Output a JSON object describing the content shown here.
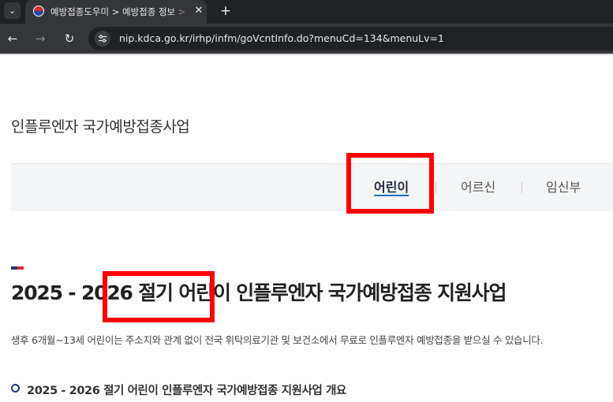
{
  "browser": {
    "tab": {
      "title": "예방접종도우미 > 예방접종 정보 > 인플루엔자",
      "close_glyph": "✕",
      "favicon": "korea-government-icon"
    },
    "new_tab_glyph": "+",
    "tab_list_glyph": "⌄",
    "nav": {
      "back_glyph": "←",
      "forward_glyph": "→",
      "reload_glyph": "↻"
    },
    "url": "nip.kdca.go.kr/irhp/infm/goVcntInfo.do?menuCd=134&menuLv=1"
  },
  "page": {
    "heading": "인플루엔자 국가예방접종사업",
    "tabs": [
      {
        "label": "어린이",
        "active": true
      },
      {
        "label": "어르신",
        "active": false
      },
      {
        "label": "임신부",
        "active": false
      }
    ],
    "section_title": "2025 - 2026 절기 어린이 인플루엔자 국가예방접종 지원사업",
    "description": "생후 6개월~13세 어린이는 주소지와 관계 없이 전국 위탁의료기관 및 보건소에서 무료로 인플루엔자 예방접종을 받으실 수 있습니다.",
    "sub_heading": "2025 - 2026 절기 어린이 인플루엔자 국가예방접종 지원사업 개요"
  },
  "colors": {
    "annotation": "#ff0000",
    "accent_navy": "#1e3a7a",
    "accent_red": "#e02a35",
    "active_underline": "#1f6fc2"
  }
}
